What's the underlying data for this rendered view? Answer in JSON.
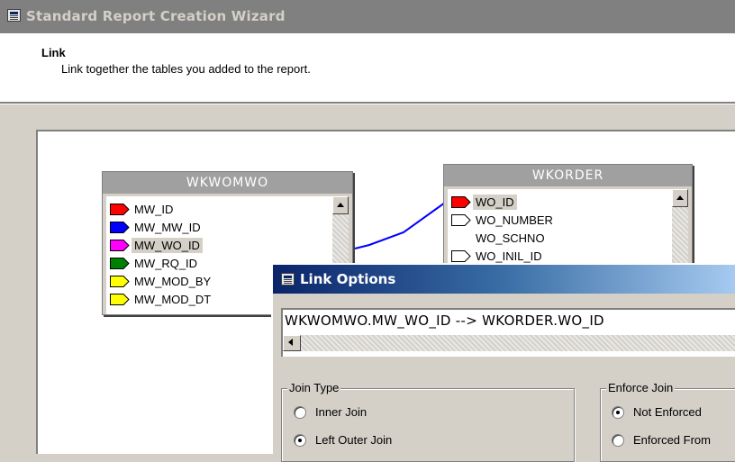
{
  "wizard": {
    "title": "Standard Report Creation Wizard",
    "step_title": "Link",
    "step_description": "Link together the tables you added to the report."
  },
  "tables": [
    {
      "name": "WKWOMWO",
      "fields": [
        {
          "label": "MW_ID",
          "flag_color": "#ff0000",
          "selected": false
        },
        {
          "label": "MW_MW_ID",
          "flag_color": "#0000ff",
          "selected": false
        },
        {
          "label": "MW_WO_ID",
          "flag_color": "#ff00ff",
          "selected": true
        },
        {
          "label": "MW_RQ_ID",
          "flag_color": "#008000",
          "selected": false
        },
        {
          "label": "MW_MOD_BY",
          "flag_color": "#ffff00",
          "selected": false
        },
        {
          "label": "MW_MOD_DT",
          "flag_color": "#ffff00",
          "selected": false
        }
      ]
    },
    {
      "name": "WKORDER",
      "fields": [
        {
          "label": "WO_ID",
          "flag_color": "#ff0000",
          "selected": true
        },
        {
          "label": "WO_NUMBER",
          "flag_color": "#ffffff",
          "selected": false
        },
        {
          "label": "WO_SCHNO",
          "flag_color": "none",
          "selected": false
        },
        {
          "label": "WO_INIL_ID",
          "flag_color": "#ffffff",
          "selected": false
        }
      ]
    }
  ],
  "link_color": "#0000ff",
  "link_options": {
    "title": "Link Options",
    "expression": "WKWOMWO.MW_WO_ID --> WKORDER.WO_ID",
    "join_type": {
      "label": "Join Type",
      "options": [
        {
          "label": "Inner Join",
          "checked": false
        },
        {
          "label": "Left Outer Join",
          "checked": true
        }
      ]
    },
    "enforce_join": {
      "label": "Enforce Join",
      "options": [
        {
          "label": "Not Enforced",
          "checked": true
        },
        {
          "label": "Enforced From",
          "checked": false
        }
      ]
    }
  }
}
